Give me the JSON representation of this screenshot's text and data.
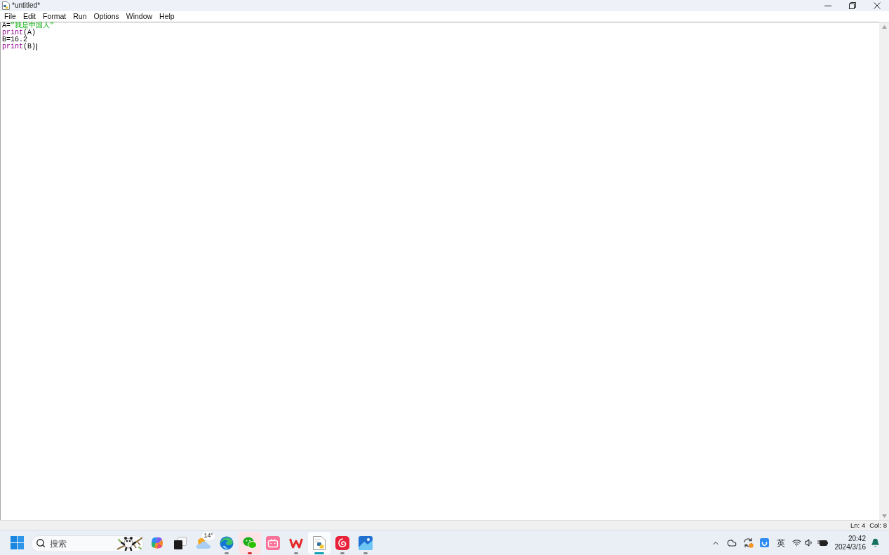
{
  "window": {
    "title": "*untitled*"
  },
  "menu": [
    "File",
    "Edit",
    "Format",
    "Run",
    "Options",
    "Window",
    "Help"
  ],
  "editor": {
    "lines": [
      {
        "tokens": [
          {
            "kind": "plain",
            "text": "A="
          },
          {
            "kind": "string",
            "text": "\"我是中国人\""
          }
        ],
        "caret": false
      },
      {
        "tokens": [
          {
            "kind": "builtin",
            "text": "print"
          },
          {
            "kind": "plain",
            "text": "(A)"
          }
        ],
        "caret": false
      },
      {
        "tokens": [
          {
            "kind": "plain",
            "text": "B=16.2"
          }
        ],
        "caret": false
      },
      {
        "tokens": [
          {
            "kind": "builtin",
            "text": "print"
          },
          {
            "kind": "plain",
            "text": "(B)"
          }
        ],
        "caret": true
      }
    ]
  },
  "status_bar": {
    "line": "Ln: 4",
    "column": "Col: 8"
  },
  "taskbar": {
    "search": {
      "placeholder": "搜索"
    },
    "apps": [
      {
        "kind": "assistant",
        "running": false,
        "selected": false,
        "flashing": false
      },
      {
        "kind": "task-view",
        "running": false,
        "selected": false,
        "flashing": false
      },
      {
        "kind": "weather",
        "label": "14°",
        "running": false,
        "selected": false,
        "flashing": false
      },
      {
        "kind": "browser",
        "running": true,
        "selected": false,
        "flashing": false
      },
      {
        "kind": "chat",
        "running": true,
        "selected": false,
        "flashing": true
      },
      {
        "kind": "video",
        "running": false,
        "selected": false,
        "flashing": false
      },
      {
        "kind": "office",
        "running": true,
        "selected": false,
        "flashing": false
      },
      {
        "kind": "editor",
        "running": true,
        "selected": true,
        "flashing": false
      },
      {
        "kind": "music",
        "running": true,
        "selected": false,
        "flashing": false
      },
      {
        "kind": "photos",
        "running": true,
        "selected": false,
        "flashing": false
      }
    ],
    "tray": {
      "input_method": "英",
      "time": "20:42",
      "date": "2024/3/16"
    }
  }
}
